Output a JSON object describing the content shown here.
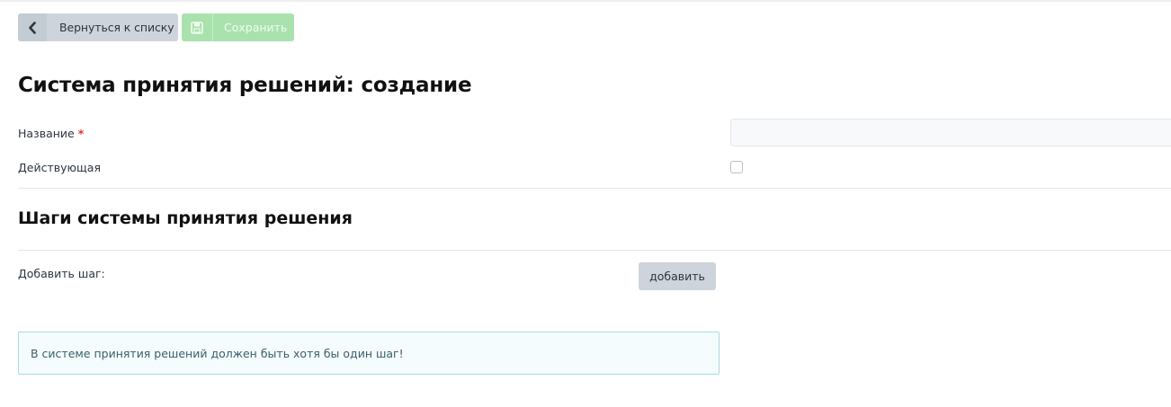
{
  "toolbar": {
    "back_label": "Вернуться к списку",
    "back_icon": "chevron-left-icon",
    "save_label": "Сохранить",
    "save_icon": "floppy-disk-icon",
    "save_color": "#a9e2ad"
  },
  "page_title": "Система принятия решений: создание",
  "form": {
    "name_label": "Название",
    "required_mark": "*",
    "name_value": "",
    "active_label": "Действующая",
    "active_checked": false
  },
  "steps": {
    "section_title": "Шаги системы принятия решения",
    "add_step_label": "Добавить шаг:",
    "add_button_label": "добавить"
  },
  "alert": {
    "text": "В системе принятия решений должен быть хотя бы один шаг!"
  }
}
